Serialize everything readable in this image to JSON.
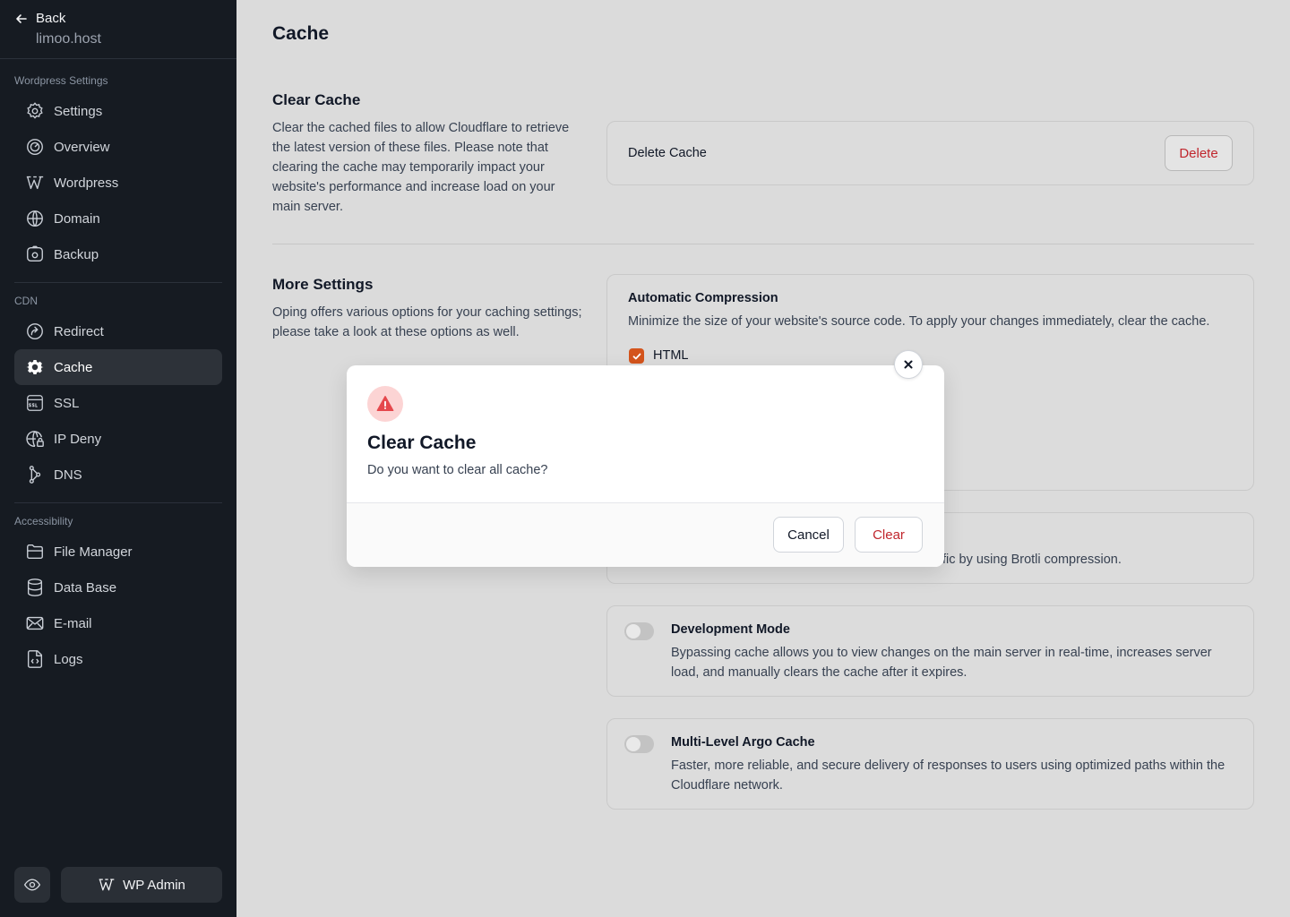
{
  "sidebar": {
    "back_label": "Back",
    "host": "limoo.host",
    "sections": {
      "wordpress": "Wordpress Settings",
      "cdn": "CDN",
      "accessibility": "Accessibility"
    },
    "items": {
      "settings": "Settings",
      "overview": "Overview",
      "wordpress": "Wordpress",
      "domain": "Domain",
      "backup": "Backup",
      "redirect": "Redirect",
      "cache": "Cache",
      "ssl": "SSL",
      "ip_deny": "IP Deny",
      "dns": "DNS",
      "file_manager": "File Manager",
      "data_base": "Data Base",
      "email": "E-mail",
      "logs": "Logs"
    },
    "wp_admin_label": "WP Admin"
  },
  "main": {
    "title": "Cache",
    "clear_cache": {
      "title": "Clear Cache",
      "description": "Clear the cached files to allow Cloudflare to retrieve the latest version of these files. Please note that clearing the cache may temporarily impact your website's performance and increase load on your main server.",
      "delete_label": "Delete Cache",
      "delete_button": "Delete"
    },
    "more_settings": {
      "title": "More Settings",
      "description": "Oping offers various options for your caching settings; please take a look at these options as well."
    },
    "compression": {
      "title": "Automatic Compression",
      "description": "Minimize the size of your website's source code. To apply your changes immediately, clear the cache.",
      "option_html": "HTML"
    },
    "brotli_partial": "fic by using Brotli compression.",
    "dev_mode": {
      "title": "Development Mode",
      "description": "Bypassing cache allows you to view changes on the main server in real-time, increases server load, and manually clears the cache after it expires."
    },
    "argo": {
      "title": "Multi-Level Argo Cache",
      "description": "Faster, more reliable, and secure delivery of responses to users using optimized paths within the Cloudflare network."
    }
  },
  "modal": {
    "title": "Clear Cache",
    "message": "Do you want to clear all cache?",
    "cancel": "Cancel",
    "confirm": "Clear"
  },
  "colors": {
    "sidebar_bg": "#161b22",
    "active_item": "#2d3239",
    "danger": "#c0262d",
    "checkbox": "#d4541c",
    "warn_bg": "#fcd4d4",
    "warn_icon": "#e5484d"
  }
}
